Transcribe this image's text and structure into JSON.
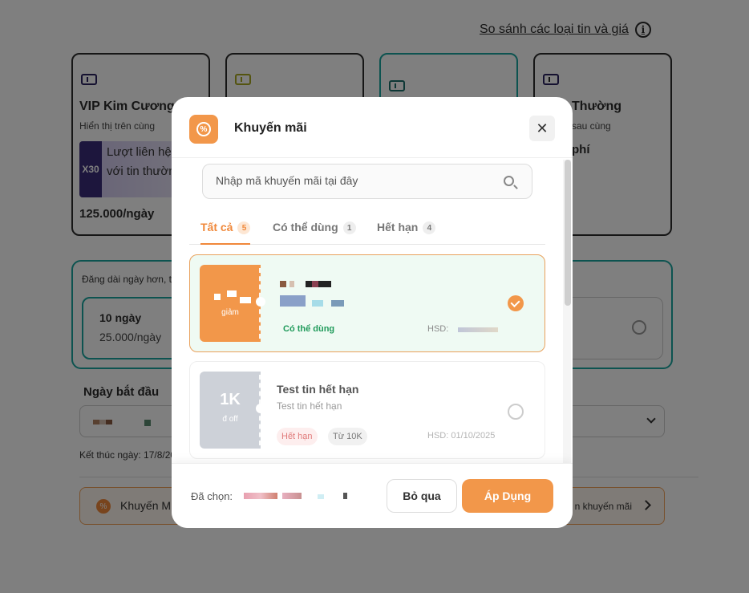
{
  "page": {
    "compare_link": "So sánh các loại tin và giá",
    "packages": [
      {
        "name": "VIP Kim Cương",
        "sub": "Hiển thị trên cùng",
        "boost_mult": "X30",
        "boost_text": "Lượt liên hệ so với tin thường",
        "price": "125.000/ngày"
      },
      {
        "name": "",
        "sub": "",
        "price": ""
      },
      {
        "name": "",
        "sub": "",
        "price": ""
      },
      {
        "name": "Thường",
        "sub": "sau cùng",
        "price": "phí"
      }
    ],
    "duration_note": "Đăng dài ngày hơn, t",
    "duration_option": {
      "days": "10 ngày",
      "price": "25.000/ngày"
    },
    "start_label": "Ngày bắt đầu",
    "end_label": "Kết thúc ngày: 17/8/20",
    "promo_label": "Khuyến M",
    "promo_right": "n khuyến mãi"
  },
  "modal": {
    "title": "Khuyến mãi",
    "close_icon": "close-icon",
    "search_placeholder": "Nhập mã khuyến mãi tại đây",
    "tabs": [
      {
        "label": "Tất cả",
        "count": "5"
      },
      {
        "label": "Có thể dùng",
        "count": "1"
      },
      {
        "label": "Hết hạn",
        "count": "4"
      }
    ],
    "coupons": [
      {
        "stub_small": "giảm",
        "status": "Có thể dùng",
        "hsd": "HSD:"
      },
      {
        "stub_big": "1K",
        "stub_small": "đ off",
        "title": "Test tin hết hạn",
        "desc": "Test tin hết hạn",
        "tag_expired": "Hết hạn",
        "tag_min": "Từ 10K",
        "hsd": "HSD: 01/10/2025"
      }
    ],
    "footer": {
      "selected_label": "Đã chọn:",
      "skip": "Bỏ qua",
      "apply": "Áp Dụng"
    }
  },
  "colors": {
    "accent": "#f2974a",
    "teal": "#1aa7a0",
    "success": "#1f9a5a"
  }
}
